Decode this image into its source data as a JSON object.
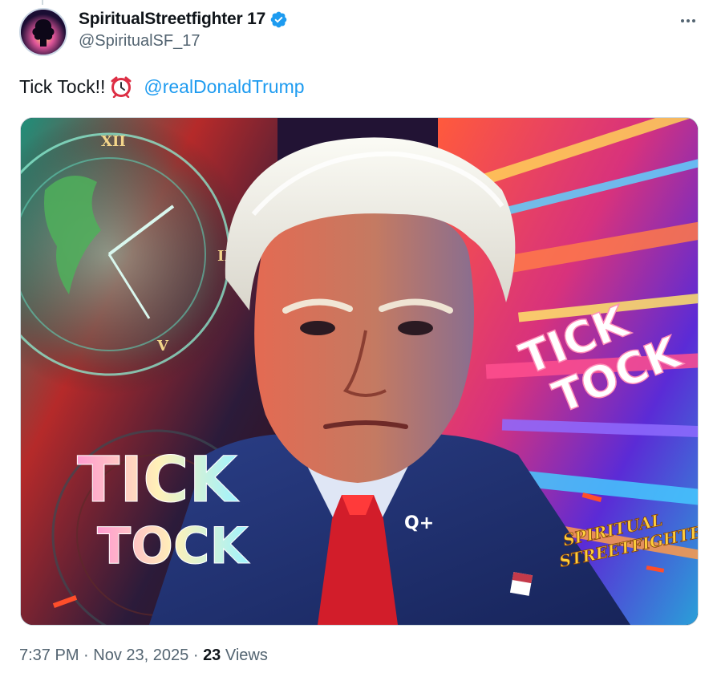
{
  "author": {
    "display_name": "SpiritualStreetfighter 17",
    "handle": "@SpiritualSF_17",
    "verified": true,
    "verified_color": "#1d9bf0"
  },
  "tweet": {
    "text": "Tick Tock!!",
    "emoji_icon": "alarm-clock-icon",
    "mention": "@realDonaldTrump"
  },
  "media": {
    "overlay_text_right_line1": "TICK",
    "overlay_text_right_line2": "TOCK",
    "overlay_text_left_line1": "TICK",
    "overlay_text_left_line2": "TOCK",
    "pin_text": "Q+",
    "logo_line1": "SPIRITUAL",
    "logo_line2": "STREETFIGHTER"
  },
  "meta": {
    "time": "7:37 PM",
    "separator": "·",
    "date": "Nov 23, 2025",
    "views_count": "23",
    "views_label": "Views"
  },
  "colors": {
    "link": "#1d9bf0",
    "secondary_text": "#536471",
    "primary_text": "#0f1419"
  }
}
